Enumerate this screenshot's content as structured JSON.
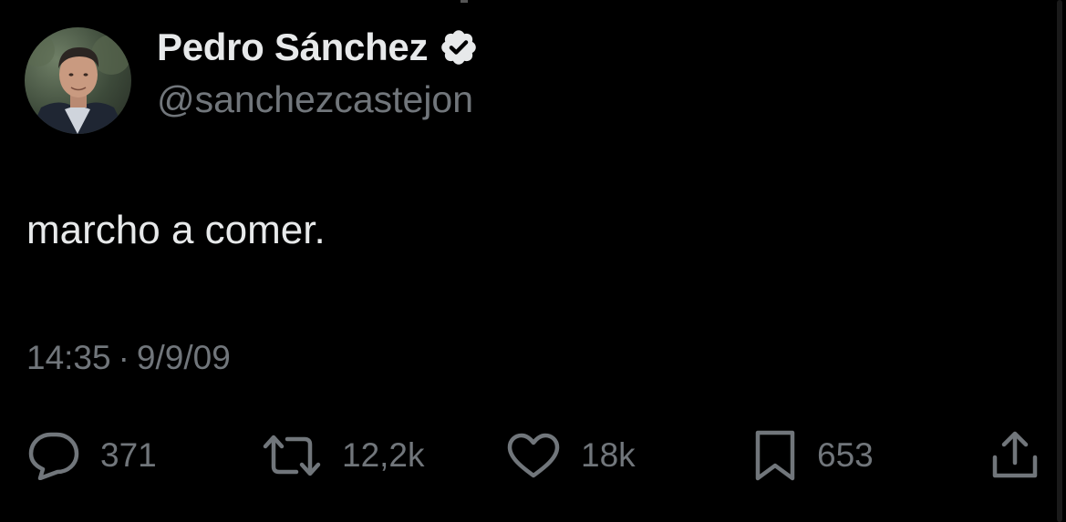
{
  "author": {
    "display_name": "Pedro Sánchez",
    "handle": "@sanchezcastejon",
    "verified": true
  },
  "tweet": {
    "text": "marcho a comer.",
    "time": "14:35",
    "separator": "·",
    "date": "9/9/09"
  },
  "actions": {
    "replies": "371",
    "reposts": "12,2k",
    "likes": "18k",
    "bookmarks": "653"
  },
  "icons": {
    "verified": "verified-badge-icon",
    "reply": "speech-bubble-icon",
    "repost": "repost-arrows-icon",
    "like": "heart-icon",
    "bookmark": "bookmark-icon",
    "share": "share-upload-icon"
  },
  "colors": {
    "background": "#000000",
    "primary_text": "#e7e9ea",
    "secondary_text": "#71767b",
    "verified_badge": "#1d9bf0"
  }
}
